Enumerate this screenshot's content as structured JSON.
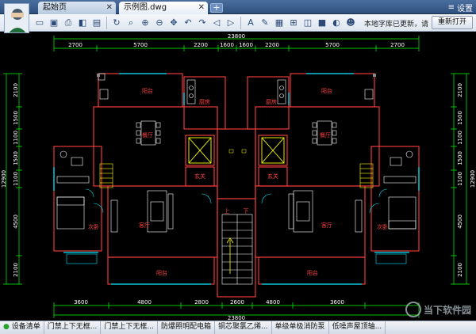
{
  "tabs": {
    "start": "起始页",
    "file": "示例图.dwg",
    "add": "+"
  },
  "window": {
    "settings": "设置"
  },
  "toolbar": {
    "status": "本地字库已更新，请",
    "reopen_label": "重新打开"
  },
  "drawing": {
    "dim_total": "23800",
    "dims_top": [
      "2700",
      "5700",
      "2200",
      "1600",
      "1600",
      "2200",
      "5700",
      "2700"
    ],
    "dims_bottom": [
      "3600",
      "4800",
      "2800",
      "2600",
      "4800",
      "3600"
    ],
    "dim_bottom_total": "23800",
    "dims_left": [
      "2100",
      "1500",
      "1100",
      "1500",
      "1100",
      "4500",
      "2100"
    ],
    "dim_left_total": "12900",
    "dims_right": [
      "2100",
      "1500",
      "1100",
      "1500",
      "1100",
      "4500",
      "2100"
    ],
    "dim_right_total": "12900",
    "rooms": {
      "balcony_tl": "阳台",
      "kitchen_l": "厨房",
      "kitchen_r": "厨房",
      "balcony_tr": "阳台",
      "restaurant_l": "餐厅",
      "restaurant_r": "餐厅",
      "entry_l": "玄关",
      "entry_r": "玄关",
      "bedroom_l": "次卧",
      "living_l": "客厅",
      "living_r": "客厅",
      "bedroom_r": "次卧",
      "balcony_bl": "阳台",
      "balcony_br": "阳台",
      "stairs_up": "上",
      "stairs_down": "下"
    }
  },
  "bottom_tabs": [
    "设备清单",
    "门禁上下无框...",
    "门禁上下无框...",
    "防爆照明配电箱",
    "铜芯聚氯乙烯...",
    "单级单极消防泵",
    "低噪声屋顶轴..."
  ],
  "watermark": "当下软件园",
  "colors": {
    "wall": "#ff4040",
    "dim": "#00ff00",
    "furniture": "#ffffff",
    "glass": "#00e5ff",
    "accent": "#ffff00"
  }
}
